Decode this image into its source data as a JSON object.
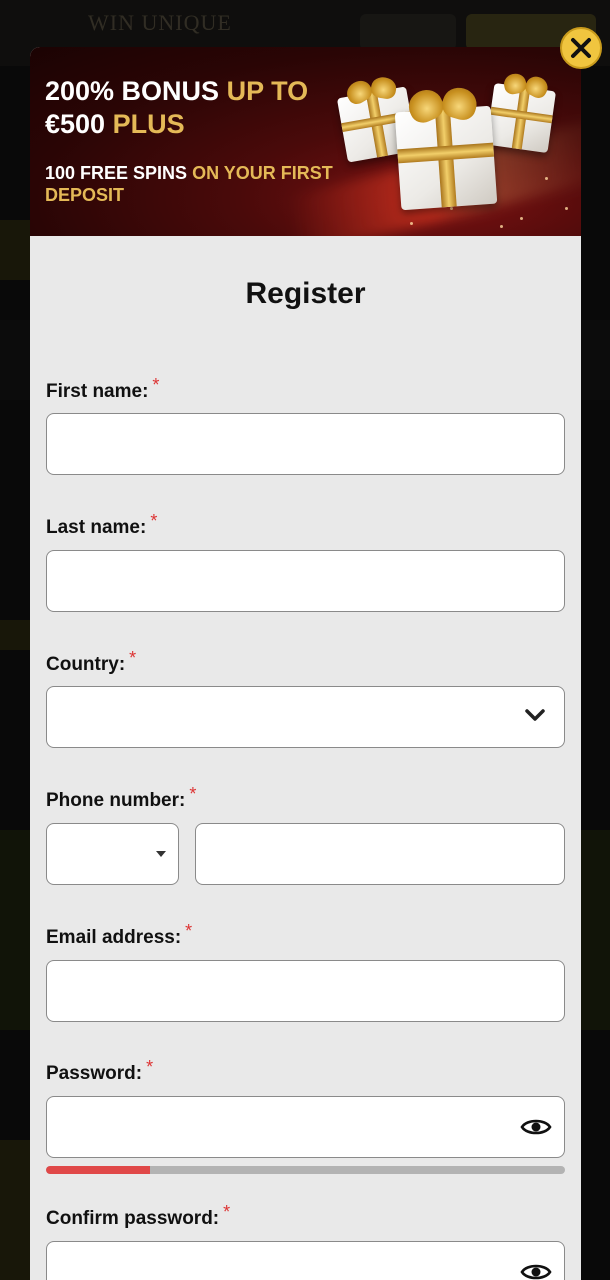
{
  "background": {
    "logo_text": "WIN UNIQUE"
  },
  "banner": {
    "headline_part1": "200% BONUS ",
    "headline_part2": "UP TO",
    "headline_part3": "€500 ",
    "headline_part4": "PLUS",
    "sub_part1": "100 FREE SPINS ",
    "sub_part2": "ON YOUR FIRST DEPOSIT"
  },
  "close_icon": "close-icon",
  "form": {
    "title": "Register",
    "required_mark": "*",
    "first_name": {
      "label": "First name:",
      "value": ""
    },
    "last_name": {
      "label": "Last name:",
      "value": ""
    },
    "country": {
      "label": "Country:",
      "value": ""
    },
    "phone": {
      "label": "Phone number:",
      "code": "",
      "value": ""
    },
    "email": {
      "label": "Email address:",
      "value": ""
    },
    "password": {
      "label": "Password:",
      "value": "",
      "strength": 0.2
    },
    "confirm_password": {
      "label": "Confirm password:",
      "value": ""
    }
  },
  "colors": {
    "accent_gold": "#e4b957",
    "close_button": "#f0c53f",
    "required": "#dd3333",
    "strength_weak": "#e04848"
  }
}
